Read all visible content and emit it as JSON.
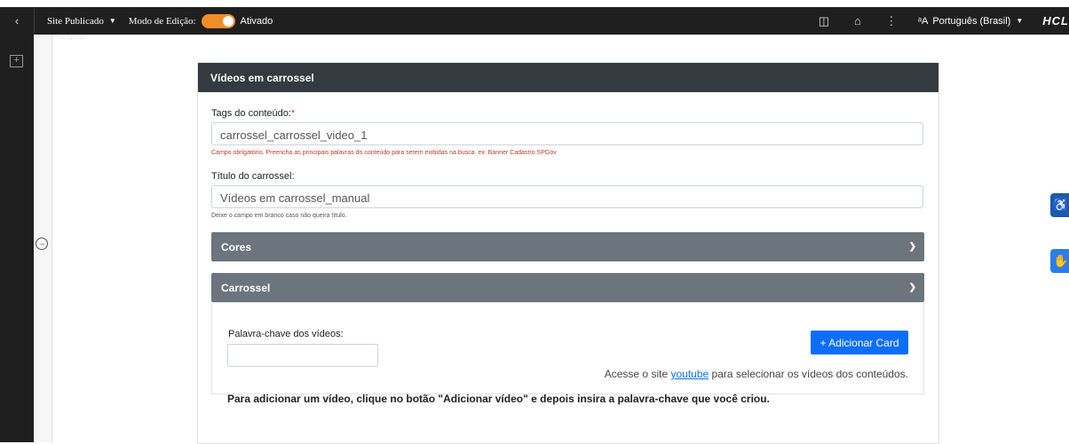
{
  "toolbar": {
    "back_icon": "chevron-left-icon",
    "site_label": "Site Publicado",
    "edit_mode_label": "Modo de Edição:",
    "edit_mode_value": "Ativado",
    "language_label": "Português (Brasil)",
    "brand": "HCL"
  },
  "form": {
    "header": "Vídeos em carrossel",
    "tags_label": "Tags do conteúdo:",
    "tags_required_mark": "*",
    "tags_value": "carrossel_carrossel_video_1",
    "tags_error": "Campo obrigatório. Preencha as principais palavras do conteúdo para serem exibidas na busca. ex: Banner Cadastro SPGov",
    "title_label": "Título do carrossel:",
    "title_value": "Vídeos em carrossel_manual",
    "title_hint": "Deixe o campo em branco caso não queira título.",
    "cores_label": "Cores",
    "carrossel_label": "Carrossel",
    "keyword_label": "Palavra-chave dos vídeos:",
    "keyword_value": "",
    "add_card_button": "+ Adicionar Card",
    "youtube_text_before": "Acesse o site",
    "youtube_link": "youtube",
    "youtube_text_after": "para selecionar os vídeos dos conteúdos.",
    "instruction": "Para adicionar um vídeo, clique no botão \"Adicionar vídeo\" e depois insira a palavra-chave que você criou."
  },
  "colors": {
    "toolbar_bg": "#1f1f1f",
    "toggle_on": "#f28c28",
    "card_header": "#343a40",
    "accordion": "#6c757d",
    "primary": "#0d6efd",
    "error": "#c0392b"
  }
}
